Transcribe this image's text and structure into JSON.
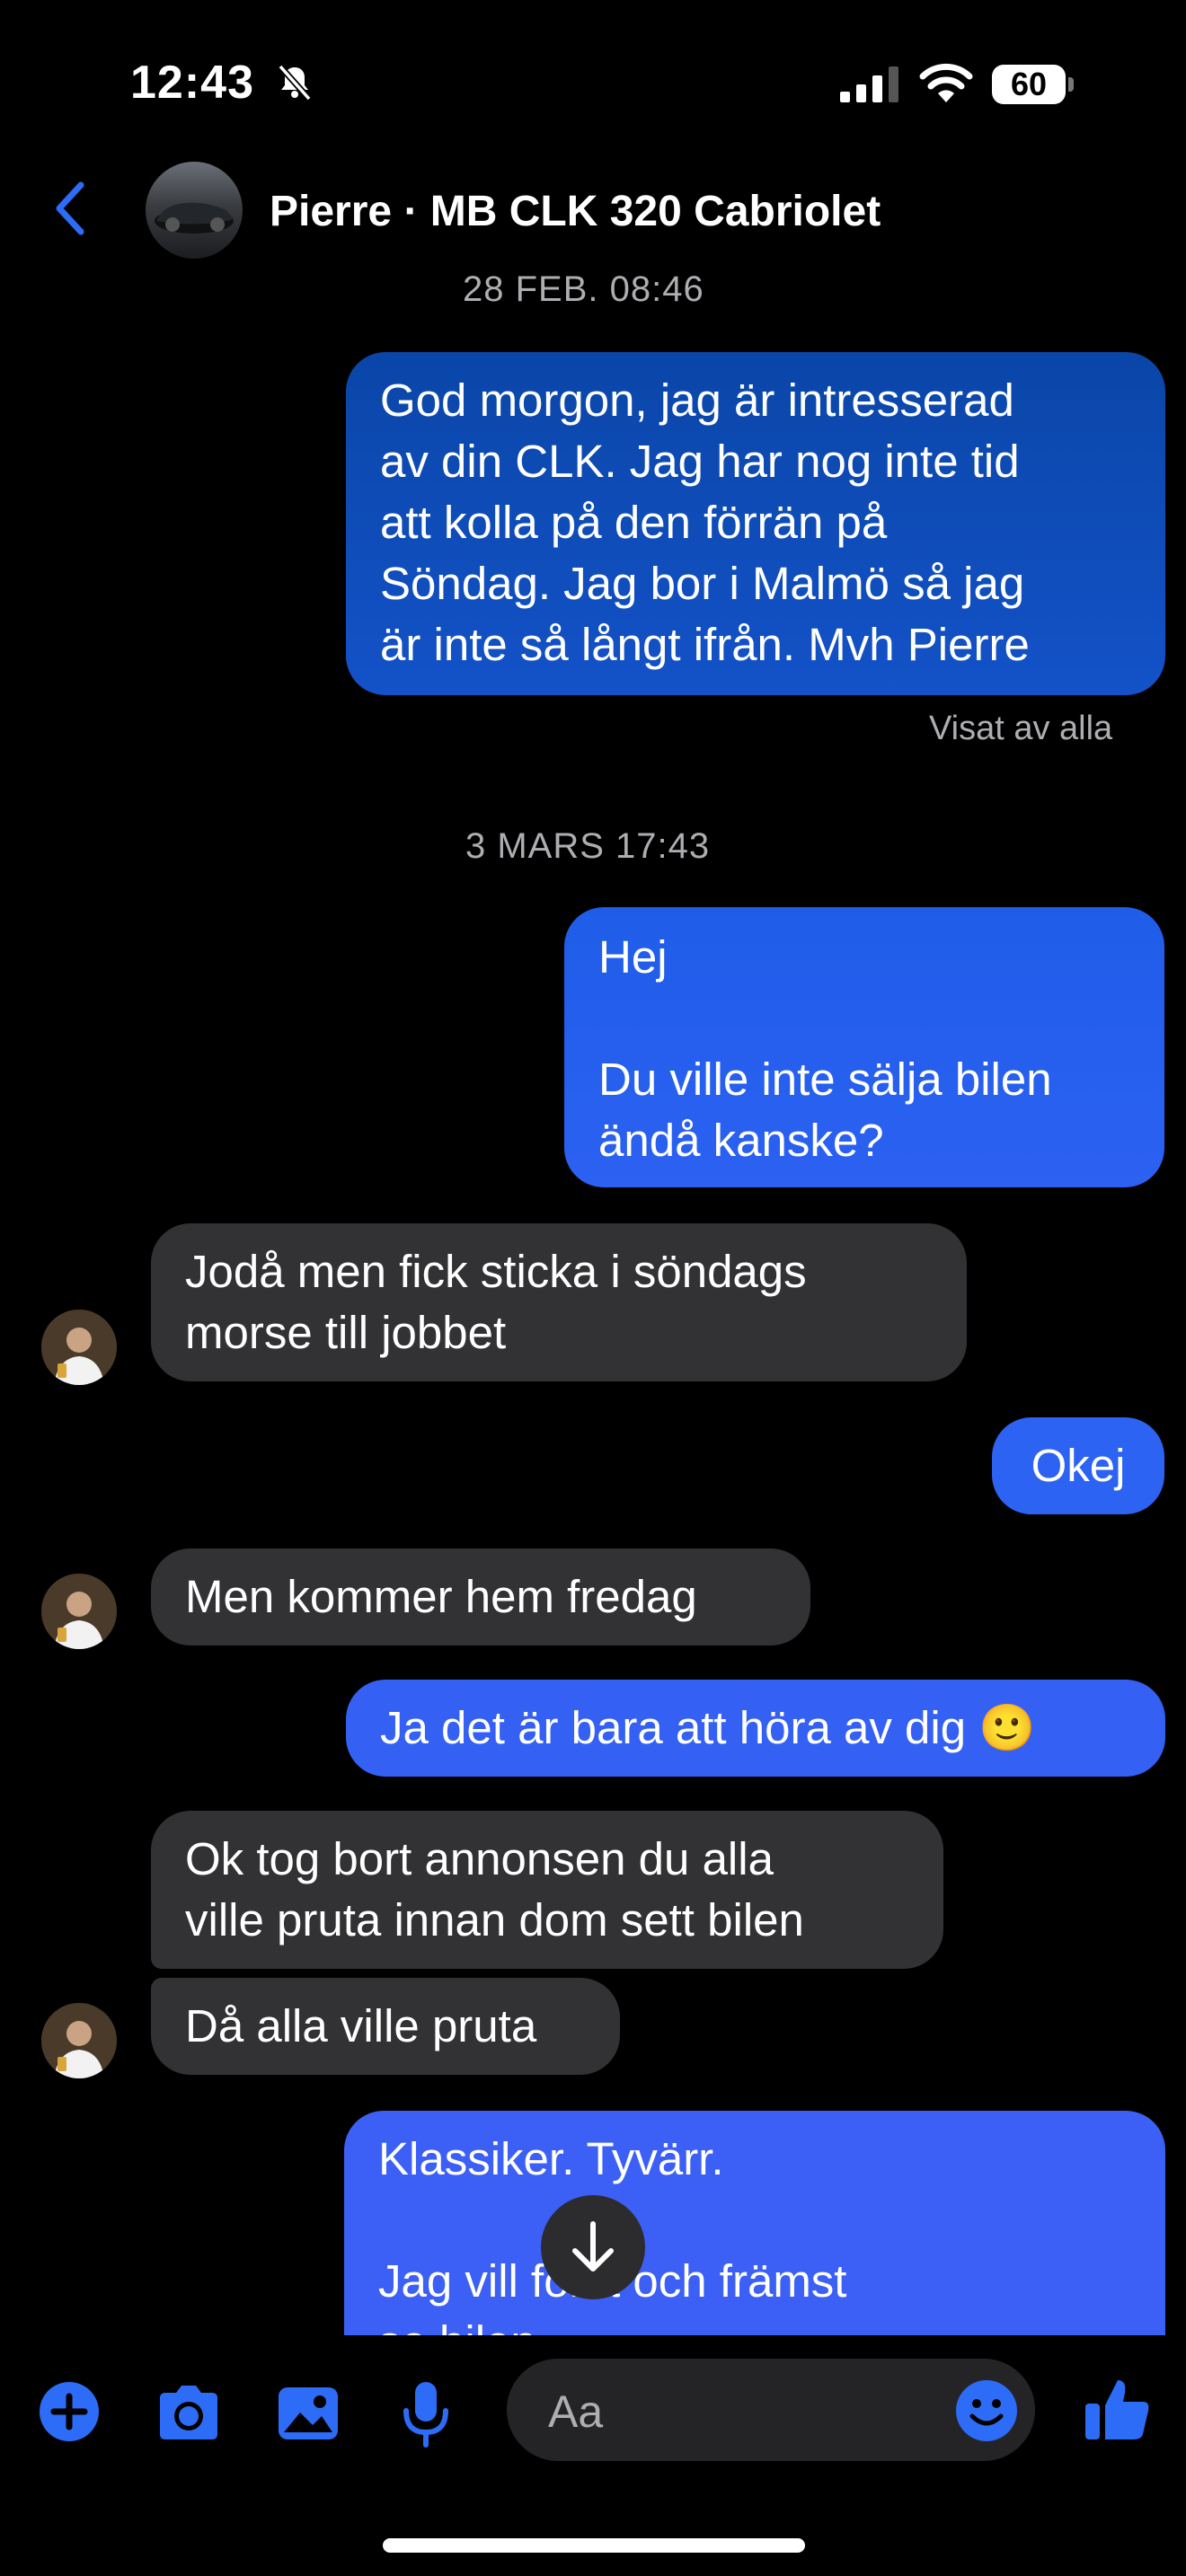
{
  "status_bar": {
    "time": "12:43",
    "battery": "60"
  },
  "header": {
    "contact": "Pierre · MB CLK 320 Cabriolet"
  },
  "timestamps": [
    "28 FEB. 08:46",
    "3 MARS 17:43"
  ],
  "messages": [
    {
      "from": "me",
      "text": "God morgon, jag är intresserad\nav din CLK. Jag har nog inte tid\natt kolla på den förrän på\nSöndag. Jag bor i Malmö så jag\när inte så långt ifrån. Mvh Pierre"
    },
    {
      "from": "me",
      "text": "Hej\n\nDu ville inte sälja bilen\nändå kanske?"
    },
    {
      "from": "them",
      "text": "Jodå men fick sticka i söndags\nmorse till jobbet"
    },
    {
      "from": "me",
      "text": "Okej"
    },
    {
      "from": "them",
      "text": "Men kommer hem fredag"
    },
    {
      "from": "me",
      "text": "Ja det är bara att höra av dig 🙂"
    },
    {
      "from": "them",
      "text": "Ok tog bort annonsen du alla\nville pruta innan dom sett bilen"
    },
    {
      "from": "them",
      "text": "Då alla ville pruta"
    },
    {
      "from": "me",
      "text": "Klassiker. Tyvärr.\n\nJag vill först och främst\nse bilen"
    }
  ],
  "seen_label": "Visat av alla",
  "composer": {
    "placeholder": "Aa"
  },
  "colors": {
    "accent": "#2d6cf6",
    "bubble_in": "#323234",
    "bubble_out_top": "#0a46a8",
    "bubble_out_bottom": "#3c60f5"
  }
}
